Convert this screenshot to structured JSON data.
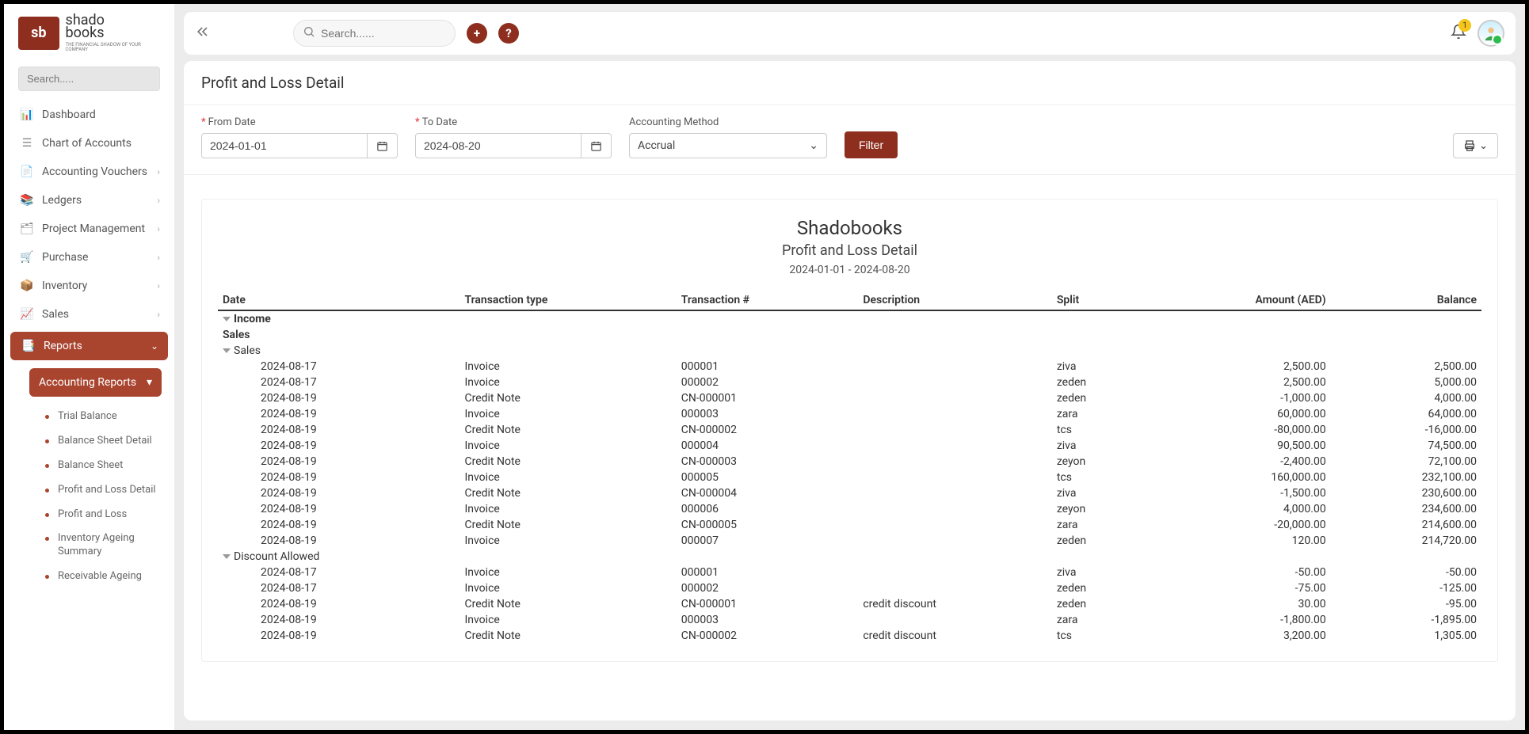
{
  "brand": {
    "logoInitials": "sb",
    "line1": "shado",
    "line2": "books",
    "subtitle": "THE FINANCIAL SHADOW OF YOUR COMPANY"
  },
  "sidebar": {
    "searchPlaceholder": "Search.....",
    "items": [
      {
        "label": "Dashboard",
        "expandable": false
      },
      {
        "label": "Chart of Accounts",
        "expandable": false
      },
      {
        "label": "Accounting Vouchers",
        "expandable": true
      },
      {
        "label": "Ledgers",
        "expandable": true
      },
      {
        "label": "Project Management",
        "expandable": true
      },
      {
        "label": "Purchase",
        "expandable": true
      },
      {
        "label": "Inventory",
        "expandable": true
      },
      {
        "label": "Sales",
        "expandable": true
      },
      {
        "label": "Reports",
        "expandable": true,
        "active": true
      }
    ],
    "subPanelLabel": "Accounting Reports",
    "subItems": [
      "Trial Balance",
      "Balance Sheet Detail",
      "Balance Sheet",
      "Profit and Loss Detail",
      "Profit and Loss",
      "Inventory Ageing Summary",
      "Receivable Ageing"
    ]
  },
  "topbar": {
    "searchPlaceholder": "Search......",
    "notificationCount": "1"
  },
  "page": {
    "title": "Profit and Loss Detail",
    "filters": {
      "fromLabel": "From Date",
      "fromValue": "2024-01-01",
      "toLabel": "To Date",
      "toValue": "2024-08-20",
      "methodLabel": "Accounting Method",
      "methodValue": "Accrual",
      "filterBtn": "Filter"
    },
    "report": {
      "company": "Shadobooks",
      "name": "Profit and Loss Detail",
      "range": "2024-01-01 - 2024-08-20",
      "columns": [
        "Date",
        "Transaction type",
        "Transaction #",
        "Description",
        "Split",
        "Amount (AED)",
        "Balance"
      ],
      "sections": [
        {
          "section": "Income",
          "link": "Sales",
          "groups": [
            {
              "name": "Sales",
              "rows": [
                {
                  "date": "2024-08-17",
                  "type": "Invoice",
                  "num": "000001",
                  "desc": "",
                  "split": "ziva",
                  "amount": "2,500.00",
                  "balance": "2,500.00"
                },
                {
                  "date": "2024-08-17",
                  "type": "Invoice",
                  "num": "000002",
                  "desc": "",
                  "split": "zeden",
                  "amount": "2,500.00",
                  "balance": "5,000.00"
                },
                {
                  "date": "2024-08-19",
                  "type": "Credit Note",
                  "num": "CN-000001",
                  "desc": "",
                  "split": "zeden",
                  "amount": "-1,000.00",
                  "balance": "4,000.00"
                },
                {
                  "date": "2024-08-19",
                  "type": "Invoice",
                  "num": "000003",
                  "desc": "",
                  "split": "zara",
                  "amount": "60,000.00",
                  "balance": "64,000.00"
                },
                {
                  "date": "2024-08-19",
                  "type": "Credit Note",
                  "num": "CN-000002",
                  "desc": "",
                  "split": "tcs",
                  "amount": "-80,000.00",
                  "balance": "-16,000.00"
                },
                {
                  "date": "2024-08-19",
                  "type": "Invoice",
                  "num": "000004",
                  "desc": "",
                  "split": "ziva",
                  "amount": "90,500.00",
                  "balance": "74,500.00"
                },
                {
                  "date": "2024-08-19",
                  "type": "Credit Note",
                  "num": "CN-000003",
                  "desc": "",
                  "split": "zeyon",
                  "amount": "-2,400.00",
                  "balance": "72,100.00"
                },
                {
                  "date": "2024-08-19",
                  "type": "Invoice",
                  "num": "000005",
                  "desc": "",
                  "split": "tcs",
                  "amount": "160,000.00",
                  "balance": "232,100.00"
                },
                {
                  "date": "2024-08-19",
                  "type": "Credit Note",
                  "num": "CN-000004",
                  "desc": "",
                  "split": "ziva",
                  "amount": "-1,500.00",
                  "balance": "230,600.00"
                },
                {
                  "date": "2024-08-19",
                  "type": "Invoice",
                  "num": "000006",
                  "desc": "",
                  "split": "zeyon",
                  "amount": "4,000.00",
                  "balance": "234,600.00"
                },
                {
                  "date": "2024-08-19",
                  "type": "Credit Note",
                  "num": "CN-000005",
                  "desc": "",
                  "split": "zara",
                  "amount": "-20,000.00",
                  "balance": "214,600.00"
                },
                {
                  "date": "2024-08-19",
                  "type": "Invoice",
                  "num": "000007",
                  "desc": "",
                  "split": "zeden",
                  "amount": "120.00",
                  "balance": "214,720.00"
                }
              ]
            },
            {
              "name": "Discount Allowed",
              "rows": [
                {
                  "date": "2024-08-17",
                  "type": "Invoice",
                  "num": "000001",
                  "desc": "",
                  "split": "ziva",
                  "amount": "-50.00",
                  "balance": "-50.00"
                },
                {
                  "date": "2024-08-17",
                  "type": "Invoice",
                  "num": "000002",
                  "desc": "",
                  "split": "zeden",
                  "amount": "-75.00",
                  "balance": "-125.00"
                },
                {
                  "date": "2024-08-19",
                  "type": "Credit Note",
                  "num": "CN-000001",
                  "desc": "credit discount",
                  "split": "zeden",
                  "amount": "30.00",
                  "balance": "-95.00"
                },
                {
                  "date": "2024-08-19",
                  "type": "Invoice",
                  "num": "000003",
                  "desc": "",
                  "split": "zara",
                  "amount": "-1,800.00",
                  "balance": "-1,895.00"
                },
                {
                  "date": "2024-08-19",
                  "type": "Credit Note",
                  "num": "CN-000002",
                  "desc": "credit discount",
                  "split": "tcs",
                  "amount": "3,200.00",
                  "balance": "1,305.00"
                }
              ]
            }
          ]
        }
      ]
    }
  }
}
